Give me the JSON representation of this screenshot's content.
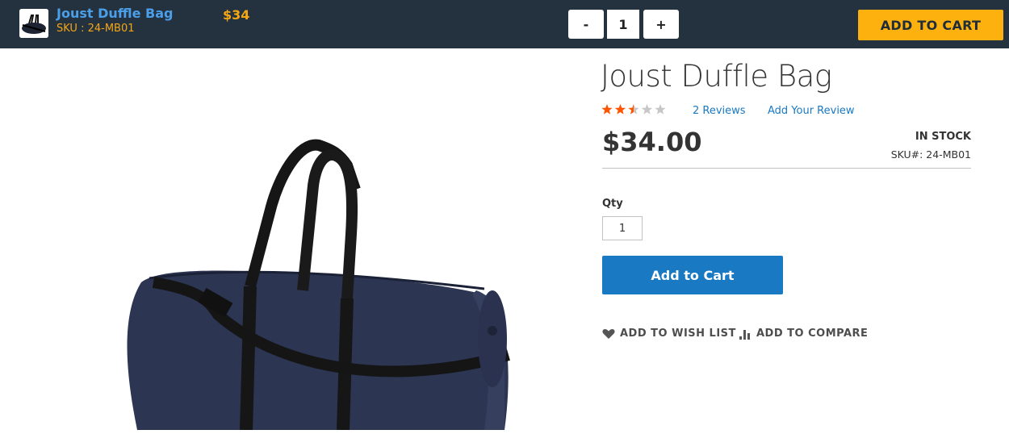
{
  "sticky_bar": {
    "product_name": "Joust Duffle Bag",
    "sku": "SKU : 24-MB01",
    "price": "$34",
    "qty_minus": "-",
    "qty_value": "1",
    "qty_plus": "+",
    "add_to_cart": "ADD TO CART"
  },
  "product": {
    "title": "Joust Duffle Bag",
    "rating": 2.5,
    "rating_max": 5,
    "reviews_link": "2  Reviews",
    "add_review_link": "Add Your Review",
    "price": "$34.00",
    "stock": "IN STOCK",
    "sku": "SKU#:  24-MB01",
    "qty_label": "Qty",
    "qty_value": "1",
    "add_to_cart": "Add to Cart",
    "wish_list": "ADD TO WISH LIST",
    "compare": "ADD TO COMPARE"
  },
  "colors": {
    "bar_bg": "#243240",
    "accent_orange": "#fdb10e",
    "link_blue": "#1979c3",
    "star_fill": "#ff5501"
  }
}
